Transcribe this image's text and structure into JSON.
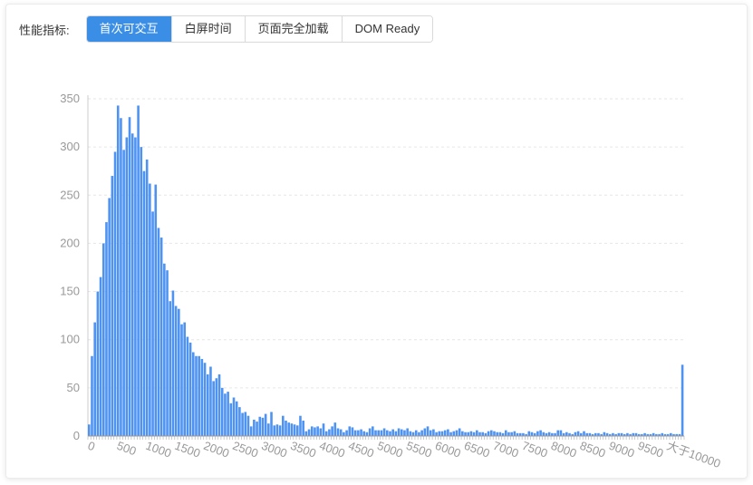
{
  "toolbar": {
    "label": "性能指标:",
    "tabs": [
      "首次可交互",
      "白屏时间",
      "页面完全加载",
      "DOM Ready"
    ],
    "active_index": 0
  },
  "colors": {
    "bar": "#4e93f2",
    "active_tab": "#3a8ee6",
    "axis_text": "#999999",
    "grid": "#e6e6e6"
  },
  "chart_data": {
    "type": "bar",
    "title": "",
    "xlabel": "",
    "ylabel": "",
    "ylim": [
      0,
      350
    ],
    "yticks": [
      0,
      50,
      100,
      150,
      200,
      250,
      300,
      350
    ],
    "xtick_labels": [
      "0",
      "500",
      "1000",
      "1500",
      "2000",
      "2500",
      "3000",
      "3500",
      "4000",
      "4500",
      "5000",
      "5500",
      "6000",
      "6500",
      "7000",
      "7500",
      "8000",
      "8500",
      "9000",
      "9500",
      "大于10000"
    ],
    "bin_width": 50,
    "grid": true,
    "values": [
      12,
      83,
      118,
      150,
      165,
      200,
      222,
      247,
      270,
      295,
      343,
      330,
      297,
      310,
      331,
      314,
      310,
      343,
      300,
      275,
      287,
      262,
      233,
      261,
      216,
      206,
      179,
      172,
      140,
      151,
      135,
      132,
      116,
      118,
      103,
      97,
      87,
      83,
      83,
      80,
      76,
      64,
      72,
      57,
      60,
      64,
      50,
      44,
      46,
      34,
      40,
      36,
      30,
      24,
      25,
      21,
      10,
      17,
      15,
      20,
      19,
      23,
      13,
      25,
      11,
      12,
      11,
      21,
      16,
      14,
      13,
      12,
      11,
      21,
      16,
      5,
      7,
      10,
      9,
      10,
      8,
      13,
      5,
      7,
      10,
      14,
      8,
      7,
      4,
      6,
      10,
      9,
      6,
      6,
      7,
      5,
      4,
      8,
      10,
      6,
      6,
      6,
      8,
      6,
      5,
      7,
      5,
      8,
      7,
      6,
      8,
      5,
      4,
      6,
      4,
      6,
      8,
      10,
      6,
      7,
      4,
      5,
      5,
      6,
      7,
      4,
      5,
      6,
      8,
      5,
      4,
      4,
      5,
      4,
      6,
      4,
      4,
      3,
      5,
      6,
      5,
      4,
      4,
      3,
      6,
      4,
      4,
      5,
      3,
      3,
      3,
      2,
      5,
      4,
      3,
      5,
      6,
      4,
      3,
      4,
      3,
      3,
      6,
      6,
      3,
      4,
      3,
      2,
      4,
      5,
      3,
      5,
      3,
      3,
      2,
      3,
      3,
      2,
      4,
      3,
      2,
      3,
      2,
      3,
      3,
      2,
      3,
      2,
      3,
      3,
      2,
      2,
      3,
      2,
      2,
      3,
      2,
      2,
      3,
      2,
      2,
      3,
      2,
      2,
      2,
      74
    ]
  }
}
